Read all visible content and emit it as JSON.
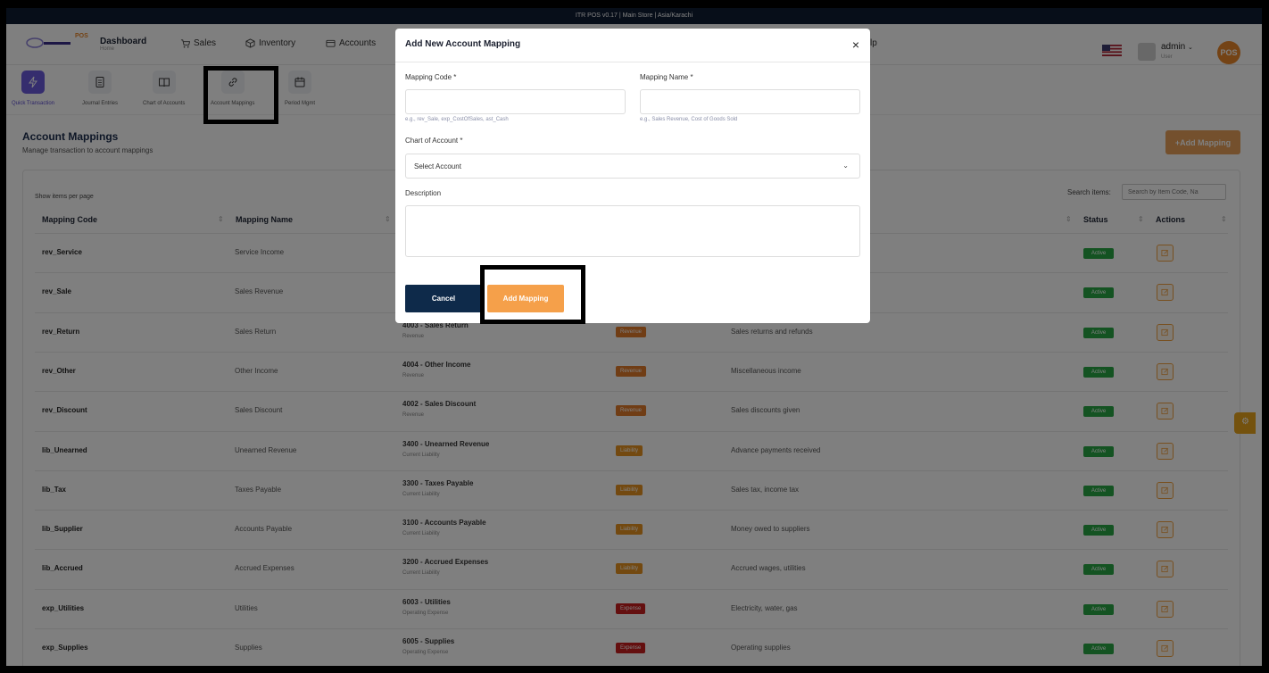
{
  "topbar": {
    "text": "ITR POS v0.17  |  Main Store  |  Asia/Karachi"
  },
  "nav": {
    "dashboard_label": "Dashboard",
    "dashboard_sub": "Home",
    "items": [
      {
        "label": "Sales",
        "icon": "cart-icon"
      },
      {
        "label": "Inventory",
        "icon": "box-icon"
      },
      {
        "label": "Accounts",
        "icon": "wallet-icon"
      }
    ],
    "help_fragment": "lp",
    "user_name": "admin",
    "user_role": "User",
    "pos_badge": "POS",
    "logo_text": "POS"
  },
  "subnav": {
    "items": [
      {
        "label": "Quick Transaction",
        "icon": "bolt-icon"
      },
      {
        "label": "Journal Entries",
        "icon": "document-icon"
      },
      {
        "label": "Chart of Accounts",
        "icon": "book-icon"
      },
      {
        "label": "Account Mappings",
        "icon": "link-icon"
      },
      {
        "label": "Period Mgmt",
        "icon": "calendar-icon"
      }
    ]
  },
  "page": {
    "title": "Account Mappings",
    "subtitle": "Manage transaction to account mappings",
    "add_button": "+Add Mapping",
    "show_items_label": "Show items per page",
    "search_label": "Search items:",
    "search_placeholder": "Search by Item Code, Na"
  },
  "table": {
    "headers": {
      "code": "Mapping Code",
      "name": "Mapping Name",
      "status": "Status",
      "actions": "Actions"
    },
    "rows": [
      {
        "code": "rev_Service",
        "name": "Service Income",
        "account": "",
        "account_type": "",
        "type": "",
        "description": "",
        "status": "Active"
      },
      {
        "code": "rev_Sale",
        "name": "Sales Revenue",
        "account": "",
        "account_type": "",
        "type": "",
        "description": "",
        "status": "Active"
      },
      {
        "code": "rev_Return",
        "name": "Sales Return",
        "account": "4003 - Sales Return",
        "account_type": "Revenue",
        "type": "Revenue",
        "description": "Sales returns and refunds",
        "status": "Active"
      },
      {
        "code": "rev_Other",
        "name": "Other Income",
        "account": "4004 - Other Income",
        "account_type": "Revenue",
        "type": "Revenue",
        "description": "Miscellaneous income",
        "status": "Active"
      },
      {
        "code": "rev_Discount",
        "name": "Sales Discount",
        "account": "4002 - Sales Discount",
        "account_type": "Revenue",
        "type": "Revenue",
        "description": "Sales discounts given",
        "status": "Active"
      },
      {
        "code": "lib_Unearned",
        "name": "Unearned Revenue",
        "account": "3400 - Unearned Revenue",
        "account_type": "Current Liability",
        "type": "Liability",
        "description": "Advance payments received",
        "status": "Active"
      },
      {
        "code": "lib_Tax",
        "name": "Taxes Payable",
        "account": "3300 - Taxes Payable",
        "account_type": "Current Liability",
        "type": "Liability",
        "description": "Sales tax, income tax",
        "status": "Active"
      },
      {
        "code": "lib_Supplier",
        "name": "Accounts Payable",
        "account": "3100 - Accounts Payable",
        "account_type": "Current Liability",
        "type": "Liability",
        "description": "Money owed to suppliers",
        "status": "Active"
      },
      {
        "code": "lib_Accrued",
        "name": "Accrued Expenses",
        "account": "3200 - Accrued Expenses",
        "account_type": "Current Liability",
        "type": "Liability",
        "description": "Accrued wages, utilities",
        "status": "Active"
      },
      {
        "code": "exp_Utilities",
        "name": "Utilities",
        "account": "6003 - Utilities",
        "account_type": "Operating Expense",
        "type": "Expense",
        "description": "Electricity, water, gas",
        "status": "Active"
      },
      {
        "code": "exp_Supplies",
        "name": "Supplies",
        "account": "6005 - Supplies",
        "account_type": "Operating Expense",
        "type": "Expense",
        "description": "Operating supplies",
        "status": "Active"
      }
    ]
  },
  "modal": {
    "title": "Add New Account Mapping",
    "close_glyph": "×",
    "mapping_code_label": "Mapping Code *",
    "mapping_code_value": "",
    "mapping_code_hint": "e.g., rev_Sale, exp_CostOfSales, ast_Cash",
    "mapping_name_label": "Mapping Name *",
    "mapping_name_value": "",
    "mapping_name_hint": "e.g., Sales Revenue, Cost of Goods Sold",
    "chart_label": "Chart of Account *",
    "chart_selected": "Select Account",
    "description_label": "Description",
    "cancel_label": "Cancel",
    "submit_label": "Add Mapping"
  },
  "colors": {
    "revenue": "#e07b2a",
    "liability": "#e69320",
    "expense": "#c81e1e",
    "active": "#28a745",
    "accent": "#f5a04a",
    "navy": "#0e2a4a"
  }
}
